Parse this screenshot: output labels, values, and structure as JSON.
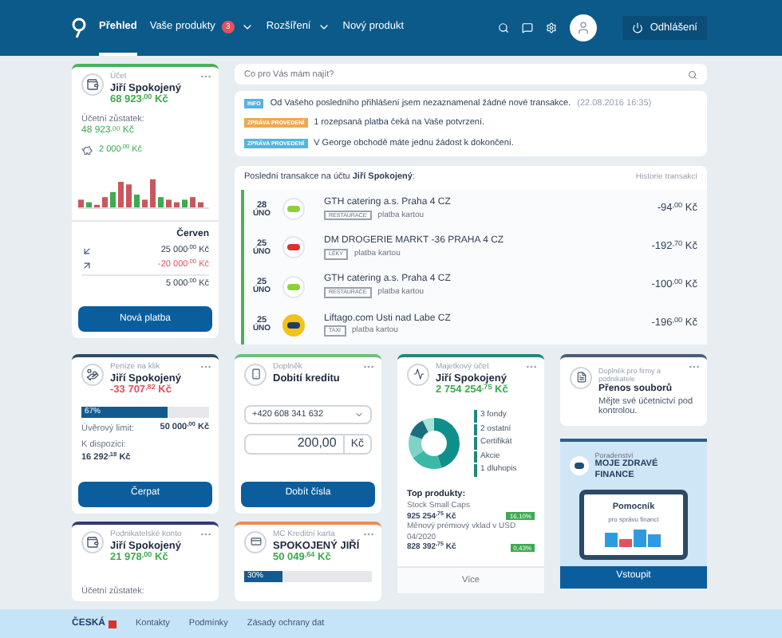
{
  "header": {
    "nav": [
      {
        "label": "Přehled",
        "selected": true,
        "dropdown": false
      },
      {
        "label": "Vaše produkty",
        "selected": false,
        "badge": "3",
        "dropdown": true
      },
      {
        "label": "Rozšíření",
        "selected": false,
        "dropdown": true
      },
      {
        "label": "Nový produkt",
        "selected": false,
        "dropdown": false
      }
    ],
    "logout": "Odhlášení"
  },
  "account": {
    "type": "Účet",
    "name": "Jiří Spokojený",
    "balance": "68 923$^{,00}$ Kč",
    "negative": false,
    "booked_label": "Účetní zůstatek:",
    "booked": "48 923$^{,00}$ Kč",
    "savings": "2 000$^{,00}$ Kč",
    "month": "Červen",
    "income": "25 000$^{,00}$ Kč",
    "expense": "-20 000$^{,00}$ Kč",
    "net": "5 000$^{,00}$ Kč",
    "button": "Nová platba"
  },
  "search": {
    "placeholder": "Co pro Vás mám najít?"
  },
  "notices": [
    {
      "kind": "info",
      "tag": "INFO",
      "text": "Od Vašeho posledního přihlášení jsem nezaznamenal žádné nové transakce.",
      "time": "(22.08.2016 16:35)"
    },
    {
      "kind": "warning",
      "tag": "ZPRÁVA PROVEDENÍ",
      "text": "1 rozepsaná platba čeká na Vaše potvrzení."
    },
    {
      "kind": "action",
      "tag": "ZPRÁVA PROVEDENÍ",
      "text": "V George obchodě máte jednu žádost k dokončení."
    }
  ],
  "transactions": {
    "title": "Poslední transakce na účtu **Jiří Spokojený**:",
    "history": "Historie transakcí",
    "rows": [
      {
        "day": "28",
        "month": "ÚNO",
        "kind": "green",
        "merchant": "GTH catering a.s. Praha 4 CZ",
        "tag": "RESTAURACE",
        "method": "platba kartou",
        "amount": "-94$^{,00}$ Kč"
      },
      {
        "day": "25",
        "month": "ÚNO",
        "kind": "dm",
        "merchant": "DM DROGERIE MARKT -36 PRAHA 4 CZ",
        "tag": "LÉKY",
        "method": "platba kartou",
        "amount": "-192$^{,70}$ Kč"
      },
      {
        "day": "25",
        "month": "ÚNO",
        "kind": "green",
        "merchant": "GTH catering a.s. Praha 4 CZ",
        "tag": "RESTAURACE",
        "method": "platba kartou",
        "amount": "-100$^{,00}$ Kč"
      },
      {
        "day": "25",
        "month": "ÚNO",
        "kind": "yellow",
        "merchant": "Liftago.com Usti nad Labe CZ",
        "tag": "TAXI",
        "method": "platba kartou",
        "amount": "-196$^{,00}$ Kč"
      }
    ]
  },
  "credit_card": {
    "type": "Peníze na klik",
    "name": "Jiří Spokojený",
    "balance": "-33 707$^{,82}$ Kč",
    "negative": true,
    "usage": "67%",
    "level": 0.67,
    "limit_label": "Úvěrový limit:",
    "limit": "50 000$^{,00}$ Kč",
    "available_label": "K dispozici:",
    "available": "16 292$^{,18}$ Kč",
    "button": "Čerpat"
  },
  "topup": {
    "type": "Doplněk",
    "title": "Dobití kreditu",
    "phone": "+420 608 341 632",
    "amount": "200,00",
    "currency": "Kč",
    "button": "Dobít čísla"
  },
  "investment": {
    "type": "Majetkový účet",
    "name": "Jiří Spokojený",
    "balance": "2 754 254$^{,75}$ Kč",
    "negative": false,
    "legend": [
      "3 fondy",
      "2 ostatní",
      "Certifikát",
      "Akcie",
      "1 dluhopis"
    ],
    "top_label": "Top produkty:",
    "products": [
      {
        "name": "Stock Small Caps",
        "value": "925 254$^{,75}$ Kč",
        "change": "16,10%"
      },
      {
        "name": "Měnový prémiový vklad v USD 04/2020",
        "value": "828 392$^{,75}$ Kč",
        "change": "0,43%"
      }
    ],
    "more": "Více"
  },
  "files": {
    "type": "Doplněk pro firmy a podnikatele",
    "title": "Přenos souborů",
    "text": "Mějte své účetnictví pod kontrolou."
  },
  "promo": {
    "type": "Poradenství",
    "title": "MOJE ZDRAVÉ FINANCE",
    "screen_title": "Pomocník",
    "screen_text": "pro správu financí",
    "button": "Vstoupit"
  },
  "business": {
    "type": "Podnikatelské konto",
    "name": "Jiří Spokojený",
    "balance": "21 978$^{,00}$ Kč",
    "negative": false,
    "booked_label": "Účetní zůstatek:"
  },
  "mastercard": {
    "type": "MC Kreditní karta",
    "name": "SPOKOJENÝ JIŘÍ",
    "balance": "50 049$^{,64}$ Kč",
    "negative": false,
    "usage": "30%",
    "level": 0.3
  },
  "footer": {
    "brand": "ČESKÁ",
    "links": [
      "Kontakty",
      "Podmínky",
      "Zásady ochrany dat"
    ]
  }
}
